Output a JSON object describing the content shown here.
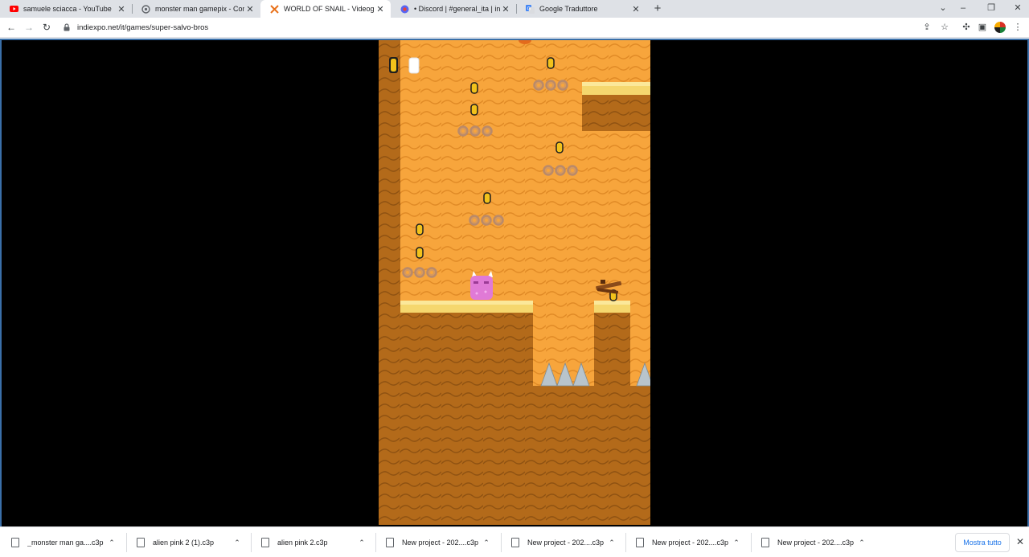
{
  "tabs": [
    {
      "title": "samuele sciacca - YouTube",
      "icon": "youtube-icon",
      "color": "#ff0000"
    },
    {
      "title": "monster man gamepix - Constru",
      "icon": "construct-icon",
      "color": "#5f6368"
    },
    {
      "title": "WORLD OF SNAIL - Videogioco",
      "icon": "indiexpo-icon",
      "color": "#e8711a",
      "active": true
    },
    {
      "title": "• Discord | #general_ita | indiexp",
      "icon": "discord-icon",
      "color": "#5865f2"
    },
    {
      "title": "Google Traduttore",
      "icon": "translate-icon",
      "color": "#4285f4"
    }
  ],
  "address_bar": {
    "url": "indiexpo.net/it/games/super-salvo-bros"
  },
  "game": {
    "name": "super-salvo-bros",
    "colors": {
      "sky": "#f7a53c",
      "ground": "#b36a1a",
      "ledge": "#f5d76e",
      "player": "#e07ad6",
      "coin": "#f2c21b"
    }
  },
  "downloads": [
    {
      "name": "_monster man ga....c3p"
    },
    {
      "name": "alien pink 2 (1).c3p"
    },
    {
      "name": "alien pink 2.c3p"
    },
    {
      "name": "New project - 202....c3p"
    },
    {
      "name": "New project - 202....c3p"
    },
    {
      "name": "New project - 202....c3p"
    },
    {
      "name": "New project - 202....c3p"
    }
  ],
  "show_all_label": "Mostra tutto"
}
